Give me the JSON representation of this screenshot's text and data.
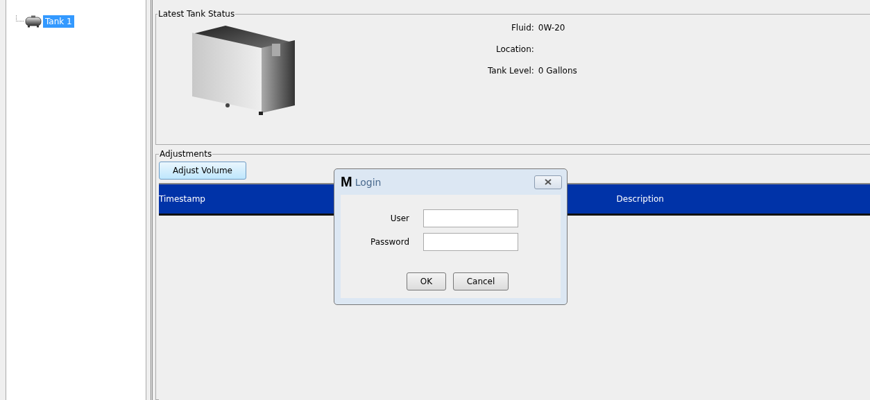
{
  "tree": {
    "items": [
      {
        "label": "Tank 1",
        "selected": true
      }
    ]
  },
  "status": {
    "title": "Latest Tank Status",
    "fields": [
      {
        "label": "Fluid:",
        "value": "0W-20"
      },
      {
        "label": "Location:"
      },
      {
        "label": "Tank Level:",
        "value": "0 Gallons"
      }
    ]
  },
  "adjustments": {
    "title": "Adjustments",
    "button": "Adjust Volume",
    "columns": [
      "Timestamp",
      "Description"
    ]
  },
  "dialog": {
    "logo": "M",
    "title": "Login",
    "fields": [
      {
        "label": "User"
      },
      {
        "label": "Password"
      }
    ],
    "buttons": [
      "OK",
      "Cancel"
    ]
  }
}
